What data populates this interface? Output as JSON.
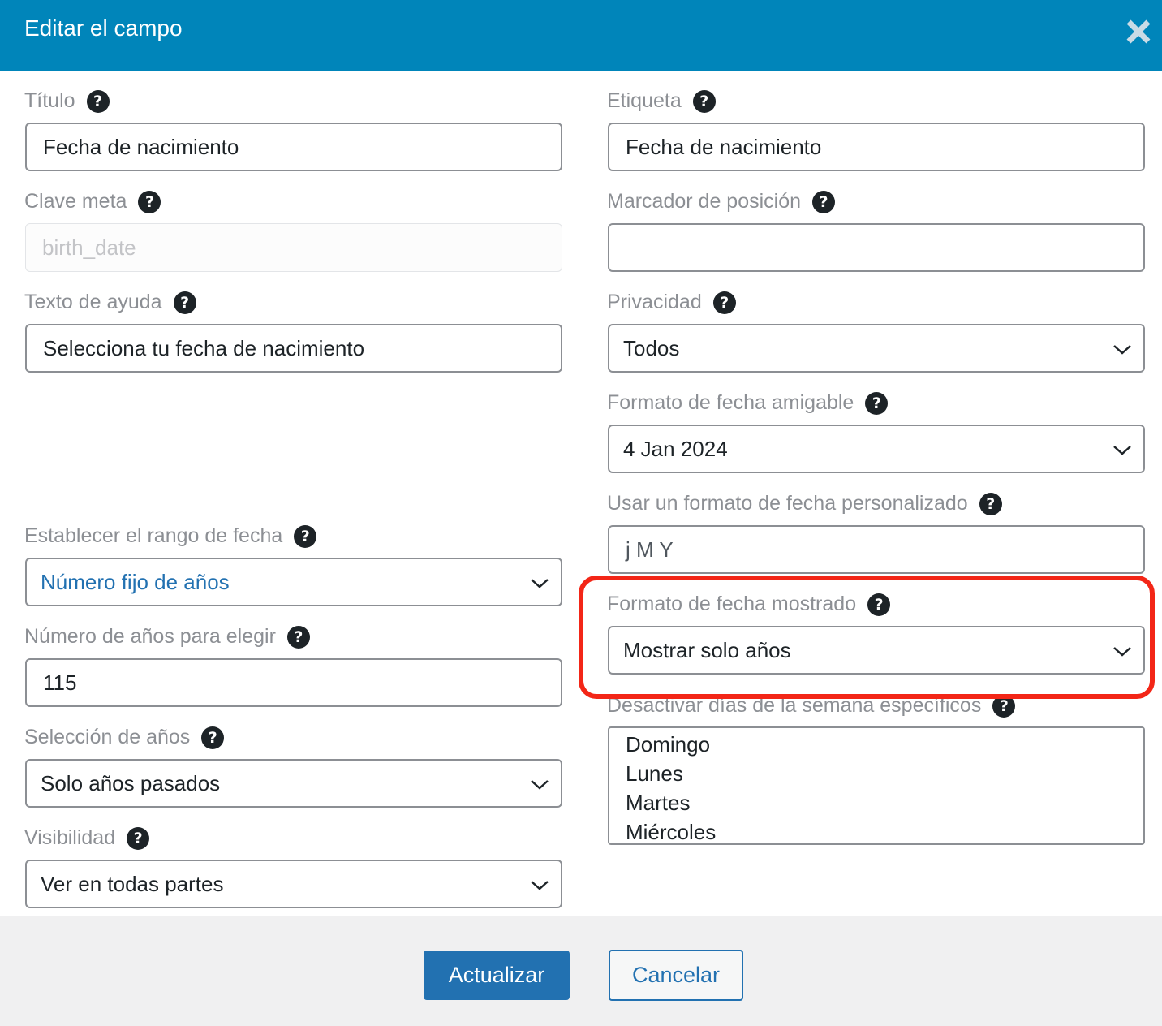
{
  "dialog": {
    "title": "Editar el campo",
    "help_glyph": "?"
  },
  "left": {
    "title_label": "Título",
    "title_value": "Fecha de nacimiento",
    "meta_key_label": "Clave meta",
    "meta_key_value": "birth_date",
    "help_text_label": "Texto de ayuda",
    "help_text_value": "Selecciona tu fecha de nacimiento",
    "date_range_label": "Establecer el rango de fecha",
    "date_range_value": "Número fijo de años",
    "years_count_label": "Número de años para elegir",
    "years_count_value": "115",
    "years_selection_label": "Selección de años",
    "years_selection_value": "Solo años pasados",
    "visibility_label": "Visibilidad",
    "visibility_value": "Ver en todas partes"
  },
  "right": {
    "label_label": "Etiqueta",
    "label_value": "Fecha de nacimiento",
    "placeholder_label": "Marcador de posición",
    "placeholder_value": "",
    "privacy_label": "Privacidad",
    "privacy_value": "Todos",
    "friendly_format_label": "Formato de fecha amigable",
    "friendly_format_value": "4 Jan 2024",
    "custom_format_label": "Usar un formato de fecha personalizado",
    "custom_format_value": "j M Y",
    "displayed_format_label": "Formato de fecha mostrado",
    "displayed_format_value": "Mostrar solo años",
    "disable_weekdays_label": "Desactivar días de la semana específicos",
    "weekdays": [
      "Domingo",
      "Lunes",
      "Martes",
      "Miércoles"
    ]
  },
  "footer": {
    "update_label": "Actualizar",
    "cancel_label": "Cancelar"
  },
  "colors": {
    "header": "#0085ba",
    "primary": "#2271b1",
    "highlight": "#f32617"
  },
  "icons": {
    "close": "close-icon",
    "help": "help-icon",
    "dropdown": "chevron-down-icon"
  }
}
